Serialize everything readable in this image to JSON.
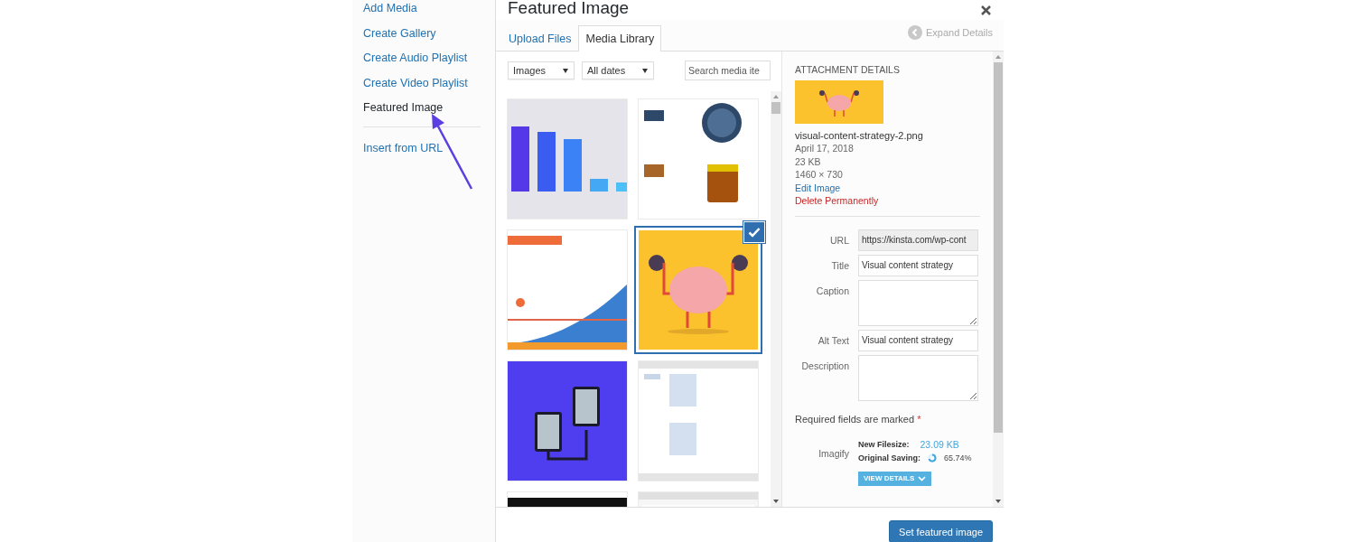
{
  "sidebar": {
    "groups": [
      {
        "items": [
          {
            "label": "Add Media",
            "selected": false
          },
          {
            "label": "Create Gallery",
            "selected": false
          },
          {
            "label": "Create Audio Playlist",
            "selected": false
          },
          {
            "label": "Create Video Playlist",
            "selected": false
          },
          {
            "label": "Featured Image",
            "selected": true
          }
        ]
      },
      {
        "items": [
          {
            "label": "Insert from URL",
            "selected": false
          }
        ]
      }
    ]
  },
  "modal": {
    "title": "Featured Image",
    "expand_details": "Expand Details"
  },
  "tabs": [
    {
      "label": "Upload Files",
      "selected": false
    },
    {
      "label": "Media Library",
      "selected": true
    }
  ],
  "filters": {
    "type": "Images",
    "date": "All dates",
    "search_placeholder": "Search media ite"
  },
  "media": [
    {
      "selected": false
    },
    {
      "selected": false
    },
    {
      "selected": false
    },
    {
      "selected": true
    },
    {
      "selected": false
    },
    {
      "selected": false
    },
    {
      "selected": false
    },
    {
      "selected": false
    }
  ],
  "details": {
    "heading": "ATTACHMENT DETAILS",
    "filename": "visual-content-strategy-2.png",
    "date": "April 17, 2018",
    "size": "23 KB",
    "dimensions": "1460 × 730",
    "edit_link": "Edit Image",
    "delete_link": "Delete Permanently",
    "fields": [
      {
        "label": "URL",
        "value": "https://kinsta.com/wp-cont",
        "kind": "input",
        "readonly": true
      },
      {
        "label": "Title",
        "value": "Visual content strategy",
        "kind": "input",
        "readonly": false
      },
      {
        "label": "Caption",
        "kind": "textarea",
        "readonly": false
      },
      {
        "label": "Alt Text",
        "value": "Visual content strategy",
        "kind": "input",
        "readonly": false
      },
      {
        "label": "Description",
        "kind": "textarea",
        "readonly": false
      }
    ],
    "required_note": "Required fields are marked",
    "required_mark": "*",
    "imagify": {
      "label": "Imagify",
      "new_filesize_label": "New Filesize:",
      "new_filesize": "23.09 KB",
      "saving_label": "Original Saving:",
      "saving": "65.74%",
      "button": "VIEW DETAILS"
    }
  },
  "footer": {
    "button": "Set featured image"
  }
}
